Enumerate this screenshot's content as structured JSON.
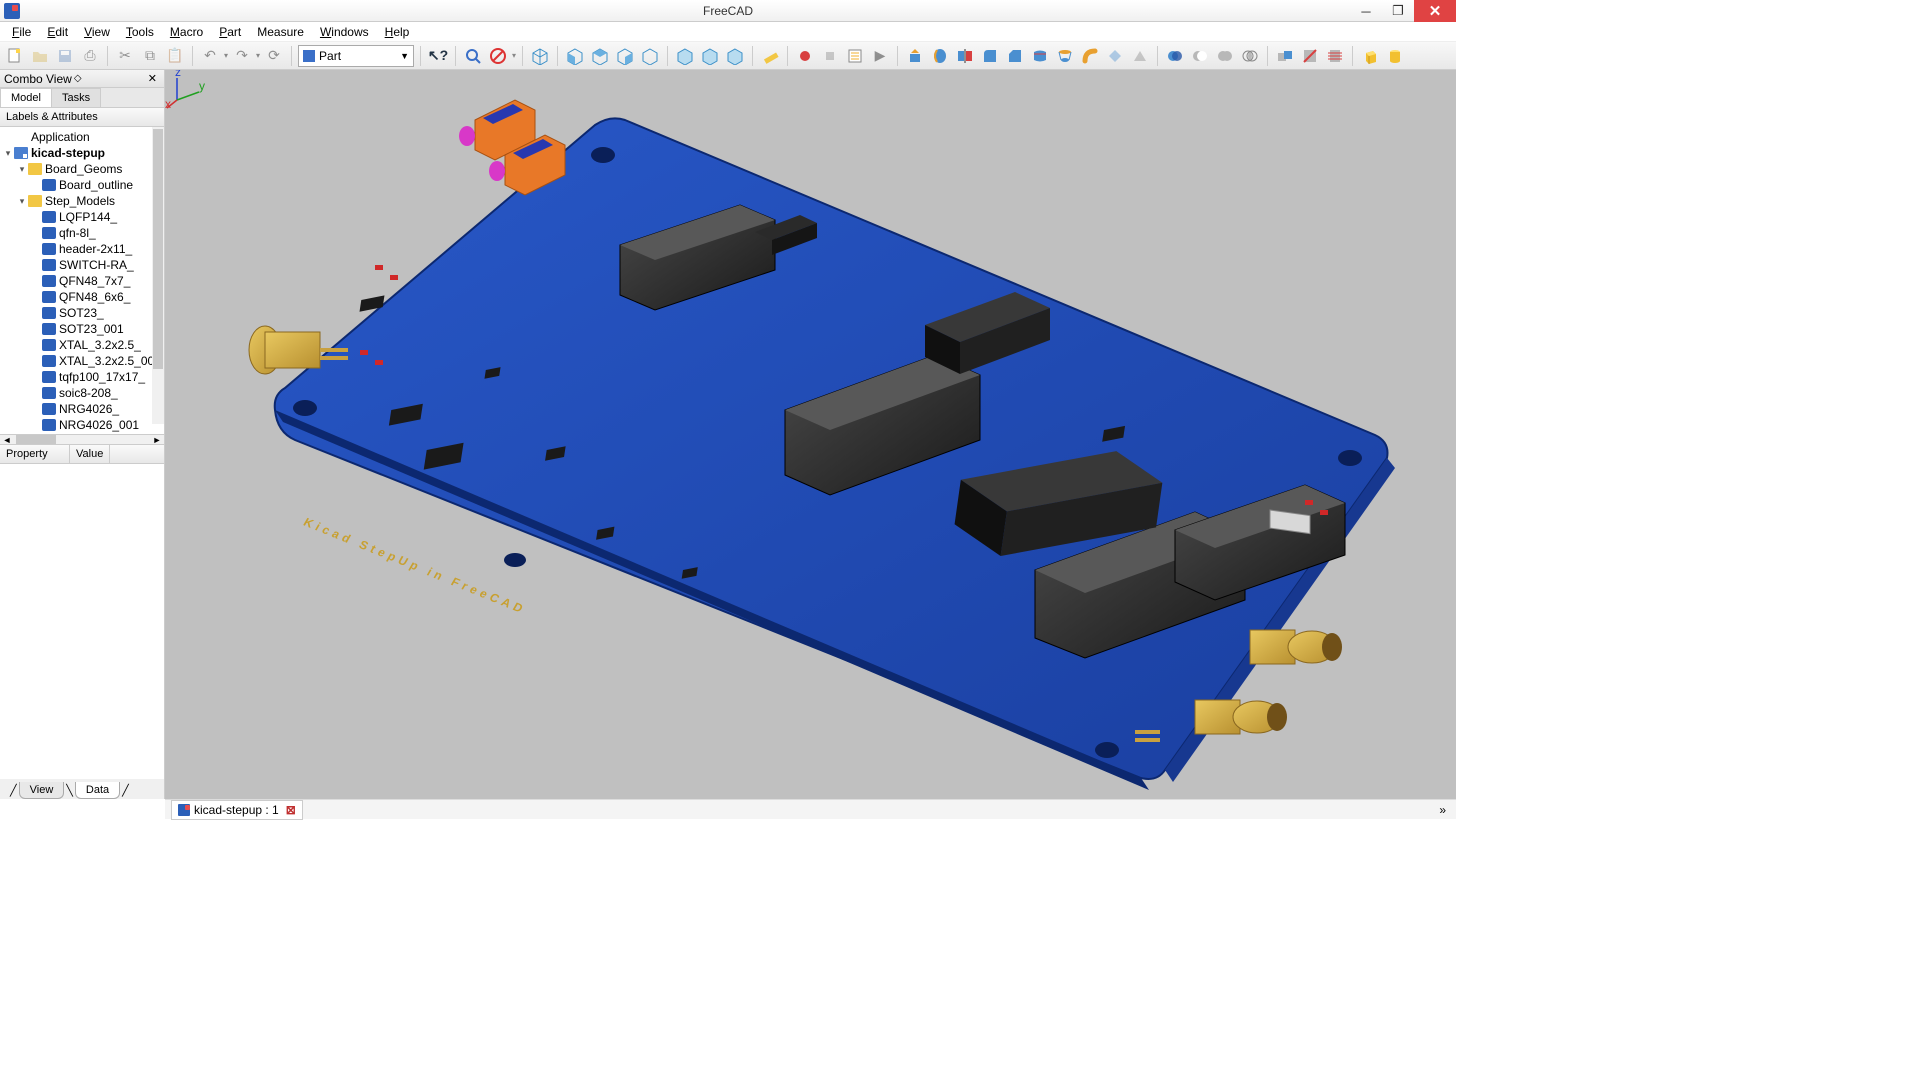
{
  "window": {
    "title": "FreeCAD"
  },
  "menus": [
    "File",
    "Edit",
    "View",
    "Tools",
    "Macro",
    "Part",
    "Measure",
    "Windows",
    "Help"
  ],
  "workbench": {
    "selected": "Part"
  },
  "combo": {
    "title": "Combo View",
    "tabs": [
      "Model",
      "Tasks"
    ],
    "tree_header": "Labels & Attributes",
    "app_label": "Application",
    "doc_label": "kicad-stepup",
    "groups": [
      {
        "label": "Board_Geoms",
        "children": [
          "Board_outline"
        ]
      },
      {
        "label": "Step_Models",
        "children": [
          "LQFP144_",
          "qfn-8l_",
          "header-2x11_",
          "SWITCH-RA_",
          "QFN48_7x7_",
          "QFN48_6x6_",
          "SOT23_",
          "SOT23_001",
          "XTAL_3.2x2.5_",
          "XTAL_3.2x2.5_00",
          "tqfp100_17x17_",
          "soic8-208_",
          "NRG4026_",
          "NRG4026_001"
        ]
      }
    ],
    "prop_cols": [
      "Property",
      "Value"
    ],
    "bottom_tabs": [
      "View",
      "Data"
    ]
  },
  "status": {
    "doc_tab": "kicad-stepup : 1"
  },
  "board_text": "Kicad StepUp in FreeCAD"
}
